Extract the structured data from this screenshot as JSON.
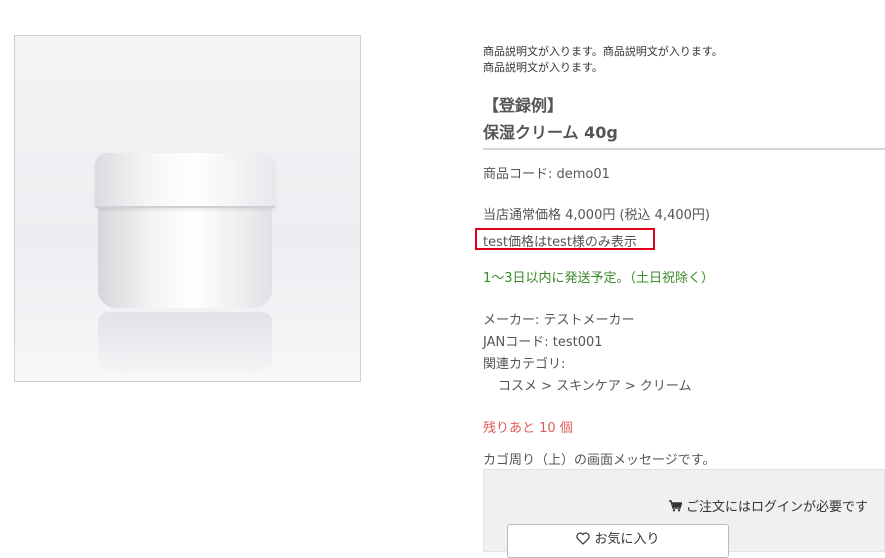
{
  "product": {
    "description_line1": "商品説明文が入ります。商品説明文が入ります。",
    "description_line2": "商品説明文が入ります。",
    "title_line1": "【登録例】",
    "title_line2": "保湿クリーム 40g",
    "code": "商品コード: demo01",
    "regular_price": "当店通常価格 4,000円 (税込 4,400円)",
    "member_price_notice": "test価格はtest様のみ表示",
    "shipping": "1〜3日以内に発送予定。（土日祝除く）",
    "maker": "メーカー: テストメーカー",
    "jan": "JANコード: test001",
    "category_label": "関連カテゴリ:",
    "category_path": "コスメ > スキンケア > クリーム",
    "stock": "残りあと 10 個",
    "cart_message": "カゴ周り（上）の画面メッセージです。"
  },
  "cart": {
    "login_required": "ご注文にはログインが必要です",
    "favorite_label": "お気に入り"
  },
  "colors": {
    "highlight_border": "#e0001a",
    "shipping_green": "#3a8a2a",
    "stock_red": "#e05a5a"
  },
  "icons": [
    "cart-icon",
    "heart-icon"
  ]
}
